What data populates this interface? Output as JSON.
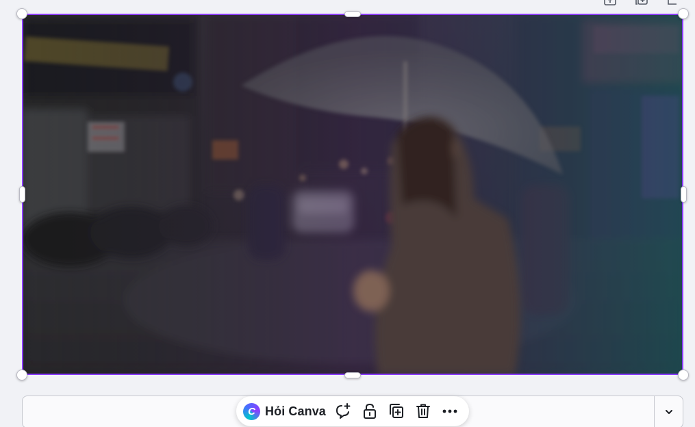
{
  "toolbar": {
    "ask_canva_label": "Hỏi Canva",
    "logo_letter": "C",
    "buttons": [
      {
        "name": "comment-add-icon"
      },
      {
        "name": "unlock-icon"
      },
      {
        "name": "duplicate-icon"
      },
      {
        "name": "delete-icon"
      },
      {
        "name": "more-icon"
      }
    ]
  },
  "colors": {
    "selection": "#8b3dff",
    "canvas_background": "#f1f2f6",
    "toolbar_background": "#ffffff"
  },
  "icons": {
    "notes_toggle": "chevron-down-icon",
    "page_top": [
      "lock-page-icon",
      "duplicate-page-icon",
      "add-page-icon"
    ]
  }
}
